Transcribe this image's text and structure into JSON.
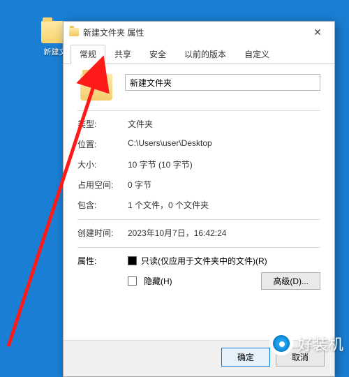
{
  "desktop": {
    "icon_label": "新建文"
  },
  "dialog": {
    "title": "新建文件夹 属性",
    "tabs": [
      "常规",
      "共享",
      "安全",
      "以前的版本",
      "自定义"
    ],
    "active_tab_index": 0,
    "folder_name": "新建文件夹",
    "rows": {
      "type": {
        "label": "类型:",
        "value": "文件夹"
      },
      "location": {
        "label": "位置:",
        "value": "C:\\Users\\user\\Desktop"
      },
      "size": {
        "label": "大小:",
        "value": "10 字节 (10 字节)"
      },
      "disk": {
        "label": "占用空间:",
        "value": "0 字节"
      },
      "contains": {
        "label": "包含:",
        "value": "1 个文件，0 个文件夹"
      },
      "created": {
        "label": "创建时间:",
        "value": "2023年10月7日，16:42:24"
      }
    },
    "attributes": {
      "label": "属性:",
      "readonly": "只读(仅应用于文件夹中的文件)(R)",
      "hidden": "隐藏(H)",
      "advanced": "高级(D)..."
    },
    "buttons": {
      "ok": "确定",
      "cancel": "取消"
    }
  },
  "watermark": "好装机"
}
